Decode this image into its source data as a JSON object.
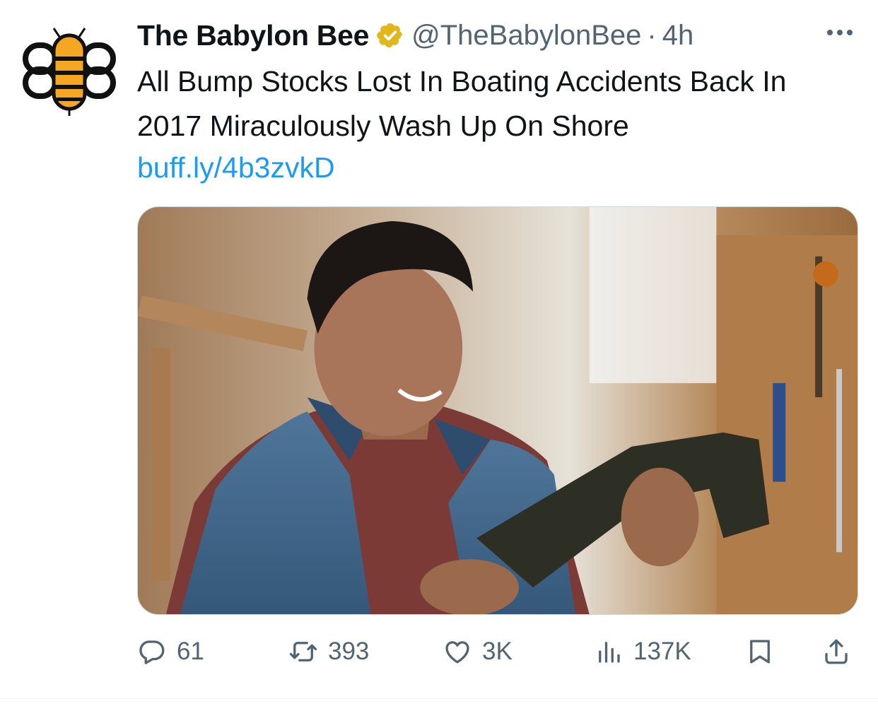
{
  "tweet": {
    "author_name": "The Babylon Bee",
    "handle": "@TheBabylonBee",
    "separator": "·",
    "time": "4h",
    "text": "All Bump Stocks Lost In Boating Accidents Back In 2017 Miraculously Wash Up On Shore",
    "link": "buff.ly/4b3zvkD"
  },
  "actions": {
    "replies": "61",
    "reposts": "393",
    "likes": "3K",
    "views": "137K"
  },
  "colors": {
    "link": "#1d9bf0",
    "secondary_text": "#536471",
    "verified_badge": "#e2b719",
    "logo_yellow": "#f5a623"
  },
  "icons": {
    "avatar": "babylon-bee-logo",
    "verified": "verified-badge-icon",
    "more": "more-icon",
    "reply": "reply-icon",
    "repost": "repost-icon",
    "like": "like-icon",
    "views": "views-icon",
    "bookmark": "bookmark-icon",
    "share": "share-icon"
  }
}
